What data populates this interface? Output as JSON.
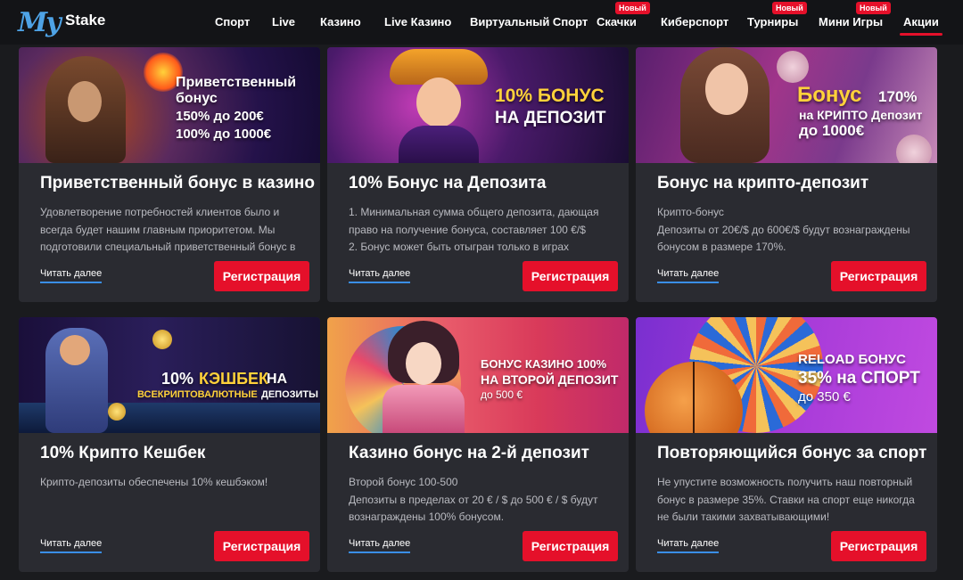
{
  "logo": {
    "my": "My",
    "stake": "Stake"
  },
  "nav": {
    "items": [
      {
        "label": "Спорт"
      },
      {
        "label": "Live"
      },
      {
        "label": "Казино"
      },
      {
        "label": "Live Казино"
      },
      {
        "label": "Виртуальный Спорт"
      },
      {
        "label": "Скачки",
        "badge": "Новый"
      },
      {
        "label": "Киберспорт"
      },
      {
        "label": "Турниры",
        "badge": "Новый"
      },
      {
        "label": "Мини Игры",
        "badge": "Новый"
      },
      {
        "label": "Акции",
        "active": true
      }
    ]
  },
  "cards": [
    {
      "banner": {
        "line1": "Приветственный",
        "line2": "бонус",
        "line3": "150% до 200€",
        "line4": "100% до 1000€"
      },
      "title": "Приветственный бонус в казино",
      "desc": "Удовлетворение потребностей клиентов было и всегда будет нашим главным приоритетом. Мы подготовили специальный приветственный бонус в",
      "read_more": "Читать далее",
      "register": "Регистрация"
    },
    {
      "banner": {
        "line1": "10% БОНУС",
        "line2": "НА ДЕПОЗИТ"
      },
      "title": "10% Бонус на Депозита",
      "desc": "1. Минимальная сумма общего депозита, дающая право на получение бонуса, составляет 100 €/$\n2. Бонус может быть отыгран только в играх",
      "read_more": "Читать далее",
      "register": "Регистрация"
    },
    {
      "banner": {
        "line1": "Бонус",
        "line1b": "170%",
        "line2": "на КРИПТО Депозит",
        "line3": "до 1000€"
      },
      "title": "Бонус на крипто-депозит",
      "desc": "Крипто-бонус\nДепозиты от 20€/$ до 600€/$ будут вознаграждены бонусом в размере 170%.",
      "read_more": "Читать далее",
      "register": "Регистрация"
    },
    {
      "banner": {
        "line1a": "10%",
        "line1b": "КЭШБЕК",
        "line1c": "НА",
        "line2a": "ВСЕКРИПТОВАЛЮТНЫЕ",
        "line2b": "ДЕПОЗИТЫ"
      },
      "title": "10% Крипто Кешбек",
      "desc": "Крипто-депозиты обеспечены 10% кешбэком!",
      "read_more": "Читать далее",
      "register": "Регистрация"
    },
    {
      "banner": {
        "line1": "БОНУС КАЗИНО 100%",
        "line2": "НА ВТОРОЙ ДЕПОЗИТ",
        "line3": "до 500 €"
      },
      "title": "Казино бонус на 2-й депозит",
      "desc": "Второй бонус 100-500\nДепозиты в пределах от 20 € / $ до 500 € / $ будут вознаграждены 100% бонусом.",
      "read_more": "Читать далее",
      "register": "Регистрация"
    },
    {
      "banner": {
        "line1": "RELOAD БОНУС",
        "line2": "35% на СПОРТ",
        "line3": "до 350 €"
      },
      "title": "Повторяющийся бонус за спорт",
      "desc": "Не упустите возможность получить наш повторный бонус в размере 35%. Ставки на спорт еще никогда не были такими захватывающими!",
      "read_more": "Читать далее",
      "register": "Регистрация"
    }
  ],
  "colors": {
    "accent": "#e5102a",
    "link_underline": "#3a8ee6",
    "card_bg": "#2a2b31",
    "page_bg": "#1a1b1e"
  }
}
